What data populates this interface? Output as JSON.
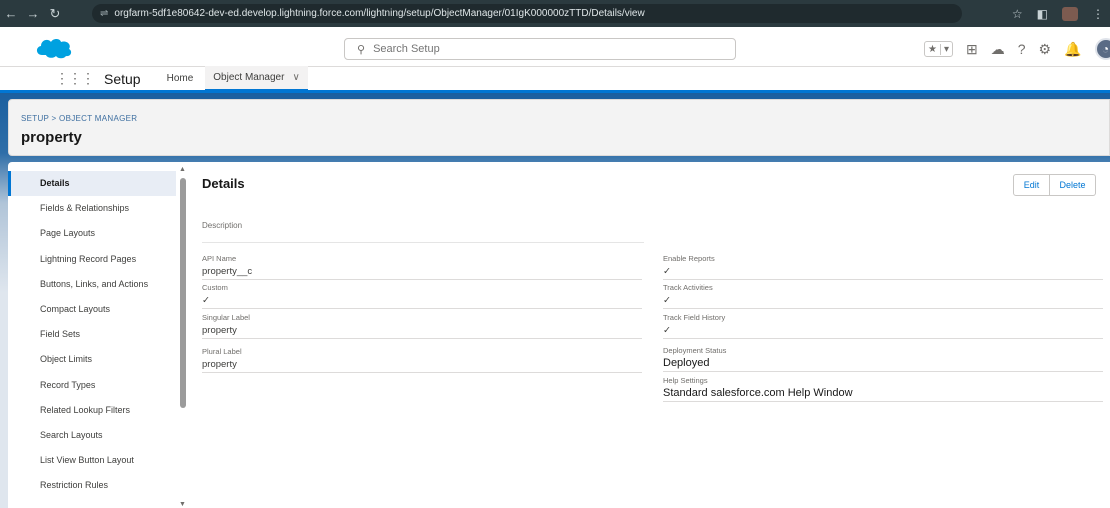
{
  "browser": {
    "back": "←",
    "forward": "→",
    "reload": "↻",
    "url": "orgfarm-5df1e80642-dev-ed.develop.lightning.force.com/lightning/setup/ObjectManager/01IgK000000zTTD/Details/view"
  },
  "header": {
    "search_placeholder": "Search Setup"
  },
  "app_nav": {
    "app_name": "Setup",
    "home": "Home",
    "object_manager": "Object Manager"
  },
  "page_header": {
    "breadcrumb": "SETUP > OBJECT MANAGER",
    "title": "property"
  },
  "sidebar": {
    "items": [
      {
        "label": "Details"
      },
      {
        "label": "Fields & Relationships"
      },
      {
        "label": "Page Layouts"
      },
      {
        "label": "Lightning Record Pages"
      },
      {
        "label": "Buttons, Links, and Actions"
      },
      {
        "label": "Compact Layouts"
      },
      {
        "label": "Field Sets"
      },
      {
        "label": "Object Limits"
      },
      {
        "label": "Record Types"
      },
      {
        "label": "Related Lookup Filters"
      },
      {
        "label": "Search Layouts"
      },
      {
        "label": "List View Button Layout"
      },
      {
        "label": "Restriction Rules"
      }
    ]
  },
  "details": {
    "title": "Details",
    "edit_label": "Edit",
    "delete_label": "Delete",
    "description_label": "Description",
    "left_fields": [
      {
        "label": "API Name",
        "value": "property__c"
      },
      {
        "label": "Custom",
        "value": "✓"
      },
      {
        "label": "Singular Label",
        "value": "property"
      },
      {
        "label": "Plural Label",
        "value": "property"
      }
    ],
    "right_fields": [
      {
        "label": "Enable Reports",
        "value": "✓"
      },
      {
        "label": "Track Activities",
        "value": "✓"
      },
      {
        "label": "Track Field History",
        "value": "✓"
      },
      {
        "label": "Deployment Status",
        "value": "Deployed"
      },
      {
        "label": "Help Settings",
        "value": "Standard salesforce.com Help Window"
      }
    ]
  }
}
